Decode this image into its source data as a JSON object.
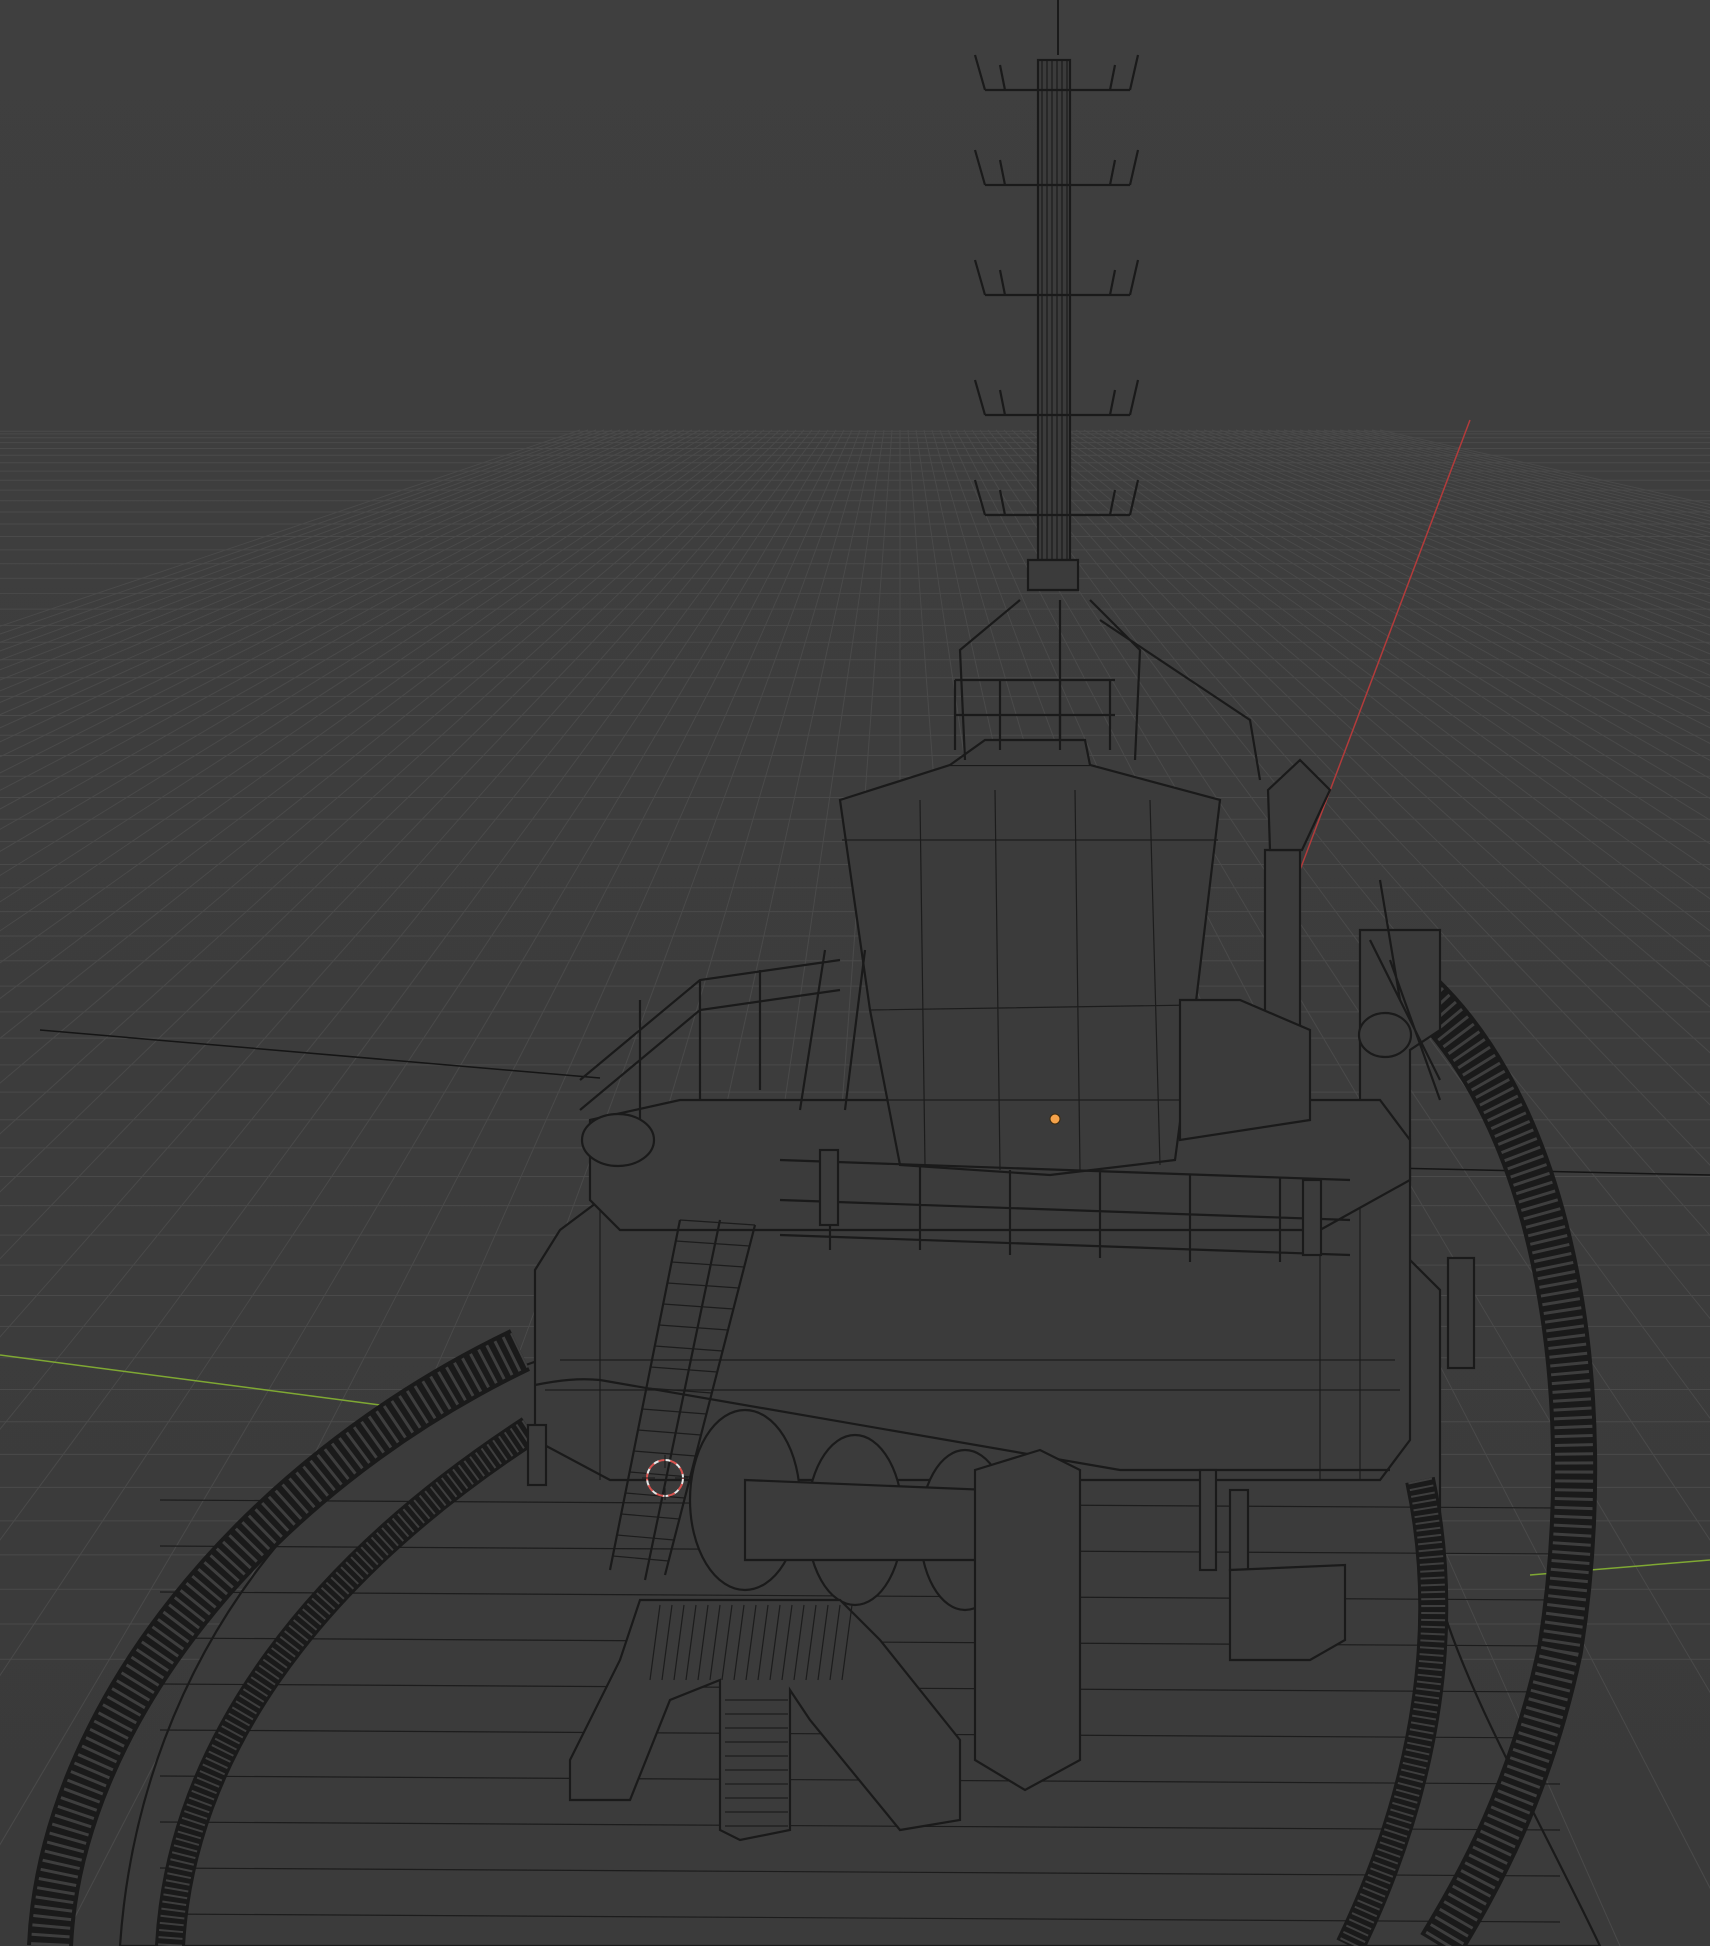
{
  "viewport": {
    "mode": "wireframe",
    "background": "#3d3d3d",
    "grid_color": "#4a4a4a",
    "wire_color": "#1a1a1a",
    "x_axis_color": "#c0392b",
    "y_axis_color": "#8fbf3a",
    "origin_color": "#f5a24a",
    "cursor_colors": [
      "#e8e8e8",
      "#d9534f"
    ]
  },
  "scene": {
    "object": "tugboat",
    "parts": [
      "mast",
      "wheelhouse",
      "exhaust-stack",
      "railings",
      "ladder",
      "winch",
      "towing-bitt",
      "fender",
      "bollards"
    ]
  }
}
